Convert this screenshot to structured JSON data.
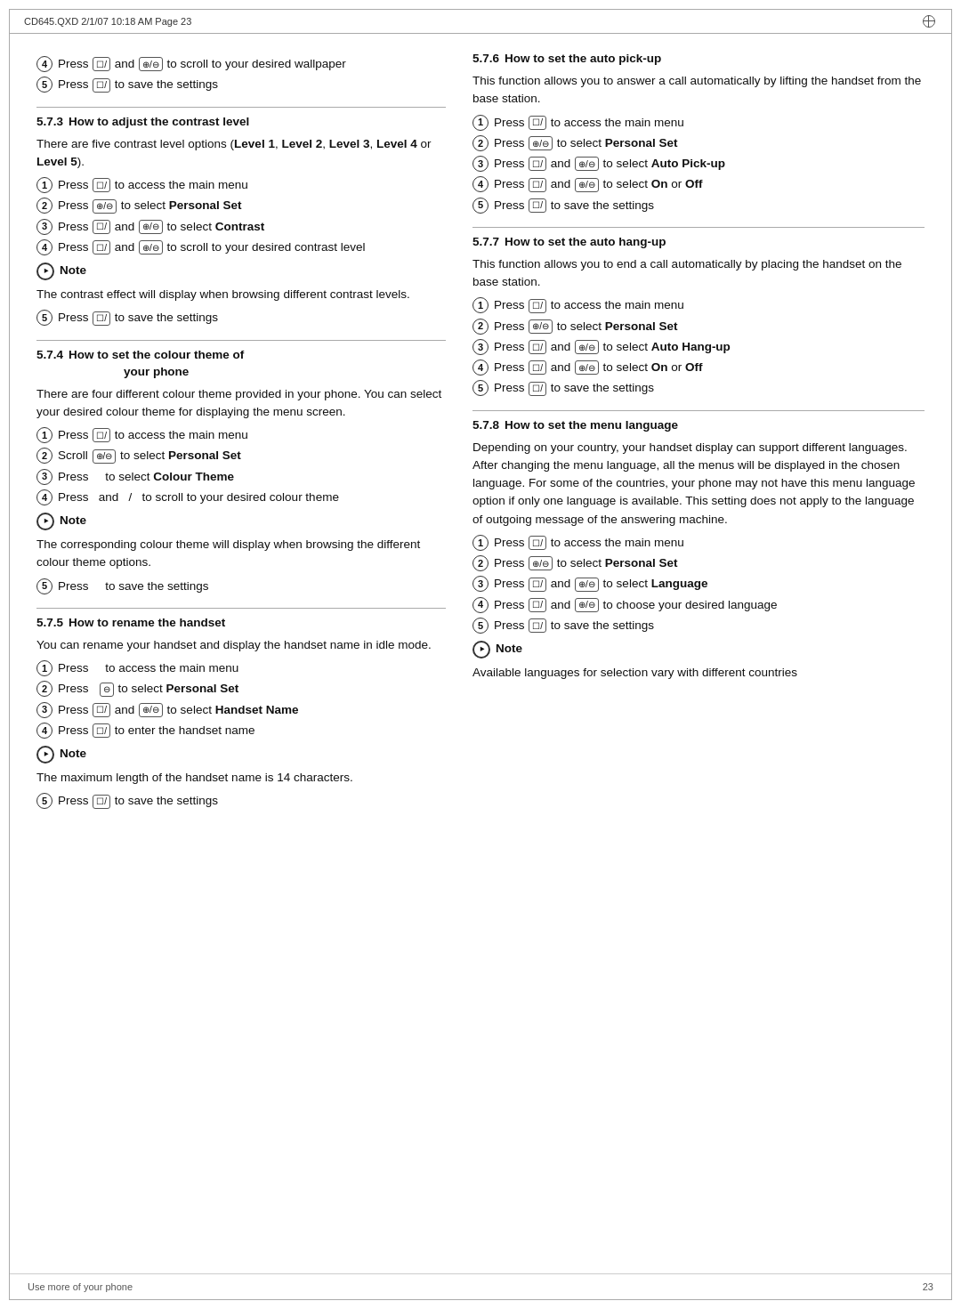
{
  "header": {
    "text": "CD645.QXD   2/1/07   10:18 AM   Page 23"
  },
  "footer": {
    "left": "Use more of your phone",
    "right": "23"
  },
  "left_col": {
    "intro_steps": [
      {
        "num": "4",
        "text_before": "Press",
        "btn1": "☐/",
        "text_mid": "and",
        "btn2": "⊕/⊖",
        "text_after": "to scroll to your desired wallpaper"
      },
      {
        "num": "5",
        "text_before": "Press",
        "btn1": "☐/",
        "text_after": "to save the settings"
      }
    ],
    "s573": {
      "id": "5.7.3",
      "title": "How to adjust the contrast level",
      "intro": "There are five contrast level options (",
      "intro_bold": "Level 1",
      "intro2": ", ",
      "intro3_bold": "Level 2",
      "intro4": ", ",
      "intro5_bold": "Level 3",
      "intro6": ", ",
      "intro7_bold": "Level 4",
      "intro8": " or ",
      "intro9_bold": "Level 5",
      "intro10": ").",
      "steps": [
        {
          "num": "1",
          "text": "Press",
          "btn": "☐/",
          "after": " to access the main menu"
        },
        {
          "num": "2",
          "text": "Press",
          "btn": "⊕/⊖",
          "after": " to select ",
          "bold": "Personal Set"
        },
        {
          "num": "3",
          "text": "Press",
          "btn": "☐/",
          "mid": " and ",
          "btn2": "⊕/⊖",
          "after": " to select ",
          "bold": "Contrast"
        },
        {
          "num": "4",
          "text": "Press",
          "btn": "☐/",
          "mid": " and ",
          "btn2": "⊕/⊖",
          "after": " to scroll to your desired contrast level"
        }
      ],
      "note_label": "Note",
      "note_text": "The contrast effect will display when browsing different contrast levels.",
      "step5": {
        "num": "5",
        "text": "Press",
        "btn": "☐/",
        "after": " to save the settings"
      }
    },
    "s574": {
      "id": "5.7.4",
      "title1": "How to set the colour theme of",
      "title2": "your phone",
      "intro": "There are four different colour theme provided in your phone. You can select your desired colour theme for displaying the menu screen.",
      "steps": [
        {
          "num": "1",
          "text": "Press",
          "btn": "☐/",
          "after": " to access the main menu"
        },
        {
          "num": "2",
          "text": "Scroll",
          "btn": "⊕/⊖",
          "after": " to select ",
          "bold": "Personal Set"
        },
        {
          "num": "3",
          "text": "Press ",
          "after": "to select ",
          "bold": "Colour Theme"
        },
        {
          "num": "4",
          "text": "Press ",
          "mid": " and ",
          "btn2_1": "⊕",
          "btn2_2": "/",
          "btn2_3": "⊖",
          "after": " to scroll to your desired colour theme"
        }
      ],
      "note_label": "Note",
      "note_text": "The corresponding colour theme will display when browsing the different colour theme options.",
      "step5": {
        "num": "5",
        "text": "Press ",
        "after": "to save the settings"
      }
    },
    "s575": {
      "id": "5.7.5",
      "title": "How to rename the handset",
      "intro": "You can rename your handset and display the handset name in idle mode.",
      "steps": [
        {
          "num": "1",
          "text": "Press ",
          "after": "to access the main menu"
        },
        {
          "num": "2",
          "text": "Press ",
          "btn": "⊖",
          "after": " to select ",
          "bold": "Personal Set"
        },
        {
          "num": "3",
          "text": "Press",
          "btn": "☐/",
          "mid": " and ",
          "btn2": "⊕/⊖",
          "after": " to select ",
          "bold1": "Handset ",
          "bold2": "Name"
        },
        {
          "num": "4",
          "text": "Press",
          "btn": "☐/",
          "after": " to enter the handset name"
        }
      ],
      "note_label": "Note",
      "note_text": "The maximum length of the handset name is 14 characters.",
      "step5": {
        "num": "5",
        "text": "Press",
        "btn": "☐/",
        "after": " to save the settings"
      }
    }
  },
  "right_col": {
    "s576": {
      "id": "5.7.6",
      "title": "How to set the auto pick-up",
      "intro": "This function allows you to answer a call automatically by lifting the handset from the base station.",
      "steps": [
        {
          "num": "1",
          "text": "Press",
          "btn": "☐/",
          "after": " to access the main menu"
        },
        {
          "num": "2",
          "text": "Press",
          "btn": "⊕/⊖",
          "after": " to select ",
          "bold": "Personal Set"
        },
        {
          "num": "3",
          "text": "Press",
          "btn": "☐/",
          "mid": " and ",
          "btn2": "⊕/⊖",
          "after": " to select ",
          "bold1": "Auto ",
          "bold2": "Pick-up"
        },
        {
          "num": "4",
          "text": "Press",
          "btn": "☐/",
          "mid": " and ",
          "btn2": "⊕/⊖",
          "after": " to select ",
          "bold": "On",
          "mid2": " or ",
          "bold2": "Off"
        },
        {
          "num": "5",
          "text": "Press",
          "btn": "☐/",
          "after": " to save the settings"
        }
      ]
    },
    "s577": {
      "id": "5.7.7",
      "title": "How to set the auto hang-up",
      "intro": "This function allows you to end a call automatically by placing the handset on the base station.",
      "steps": [
        {
          "num": "1",
          "text": "Press",
          "btn": "☐/",
          "after": " to access the main menu"
        },
        {
          "num": "2",
          "text": "Press",
          "btn": "⊕/⊖",
          "after": " to select ",
          "bold": "Personal Set"
        },
        {
          "num": "3",
          "text": "Press",
          "btn": "☐/",
          "mid": " and ",
          "btn2": "⊕/⊖",
          "after": " to select ",
          "bold1": "Auto ",
          "bold2": "Hang-up"
        },
        {
          "num": "4",
          "text": "Press",
          "btn": "☐/",
          "mid": " and ",
          "btn2": "⊕/⊖",
          "after": " to select ",
          "bold": "On",
          "mid2": " or ",
          "bold2": "Off"
        },
        {
          "num": "5",
          "text": "Press",
          "btn": "☐/",
          "after": " to save the settings"
        }
      ]
    },
    "s578": {
      "id": "5.7.8",
      "title": "How to set the menu language",
      "intro": "Depending on your country, your handset display can support different languages. After changing the menu language, all the menus will be displayed in the chosen language.  For some of the countries, your phone may not have this menu language option if only one language is available.  This setting does not apply to the language of outgoing message of the answering machine.",
      "steps": [
        {
          "num": "1",
          "text": "Press",
          "btn": "☐/",
          "after": " to access the main menu"
        },
        {
          "num": "2",
          "text": "Press",
          "btn": "⊕/⊖",
          "after": " to select ",
          "bold": "Personal Set"
        },
        {
          "num": "3",
          "text": "Press",
          "btn": "☐/",
          "mid": " and ",
          "btn2": "⊕/⊖",
          "after": " to select ",
          "bold": "Language"
        },
        {
          "num": "4",
          "text": "Press",
          "btn": "☐/",
          "mid": " and ",
          "btn2": "⊕/⊖",
          "after": " to choose your desired language"
        },
        {
          "num": "5",
          "text": "Press",
          "btn": "☐/",
          "after": " to save the settings"
        }
      ],
      "note_label": "Note",
      "note_text": "Available languages for selection vary with different countries"
    }
  }
}
